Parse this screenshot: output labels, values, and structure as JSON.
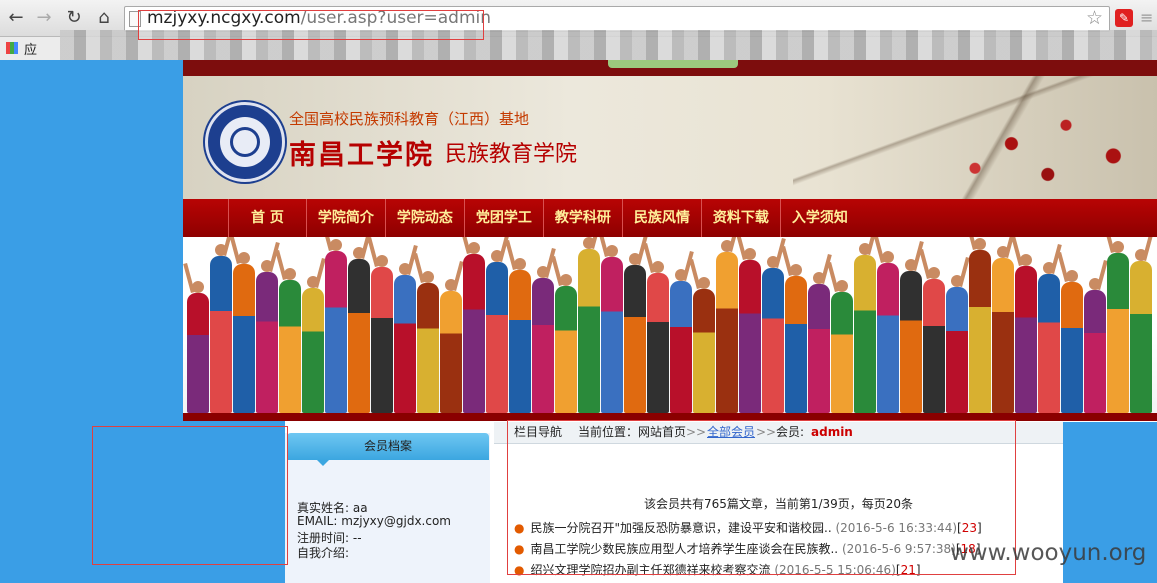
{
  "browser": {
    "url_host": "mzjyxy.ncgxy.com",
    "url_rest": "/user.asp?user=admin",
    "bookmarks_label": "应",
    "icons": {
      "back": "back-arrow-icon",
      "forward": "forward-arrow-icon",
      "reload": "reload-icon",
      "home": "home-icon",
      "star": "bookmark-star-icon"
    }
  },
  "banner": {
    "subtitle": "全国高校民族预科教育（江西）基地",
    "university": "南昌工学院",
    "college": "民族教育学院"
  },
  "nav": [
    "首 页",
    "学院简介",
    "学院动态",
    "党团学工",
    "教学科研",
    "民族风情",
    "资料下载",
    "入学须知"
  ],
  "sidebar": {
    "title": "会员档案",
    "fields": [
      {
        "label": "真实姓名:",
        "value": "aa"
      },
      {
        "label": "EMAIL:",
        "value": "mzjyxy@gjdx.com"
      },
      {
        "label": "注册时间:",
        "value": "--"
      },
      {
        "label": "自我介绍:",
        "value": ""
      }
    ]
  },
  "main": {
    "crumb_label": "栏目导航",
    "position_label": "当前位置：",
    "home": "网站首页",
    "sep": ">>",
    "all_members": "全部会员",
    "member_label": "会员:",
    "user": "admin",
    "stats": "该会员共有765篇文章，当前第1/39页，每页20条",
    "articles": [
      {
        "title": "民族一分院召开\"加强反恐防暴意识，建设平安和谐校园..",
        "date": "(2016-5-6 16:33:44)",
        "count": "23"
      },
      {
        "title": "南昌工学院少数民族应用型人才培养学生座谈会在民族教..",
        "date": "(2016-5-6 9:57:38)",
        "count": "18"
      },
      {
        "title": "绍兴文理学院招办副主任郑德祥来校考察交流",
        "date": "(2016-5-5 15:06:46)",
        "count": "21"
      }
    ]
  },
  "watermark": "www.wooyun.org",
  "colors": {
    "page_bg": "#3a9ee6",
    "nav_red": "#b80404",
    "nav_text": "#ffef9a",
    "highlight": "#e04040"
  }
}
